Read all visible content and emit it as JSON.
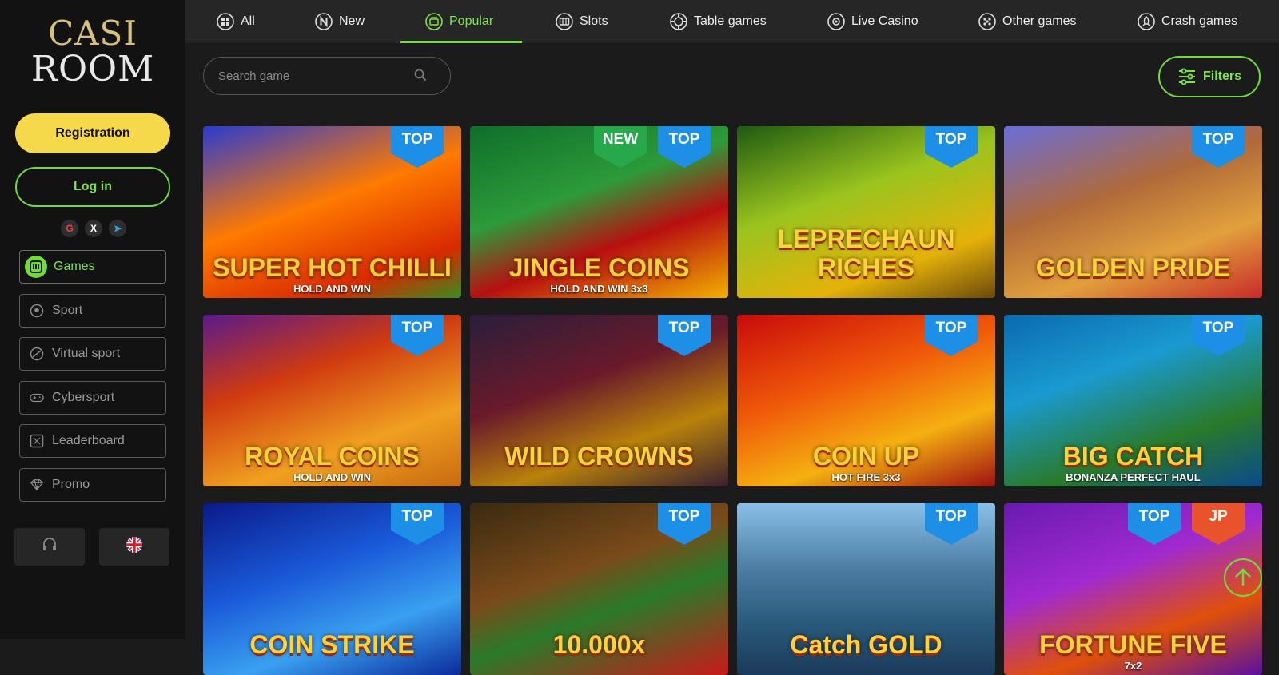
{
  "logo": {
    "line1": "CASI",
    "line2": "ROOM"
  },
  "auth": {
    "registration_label": "Registration",
    "login_label": "Log in"
  },
  "socials": [
    {
      "icon": "google-icon",
      "glyph": "G"
    },
    {
      "icon": "x-icon",
      "glyph": "X"
    },
    {
      "icon": "telegram-icon",
      "glyph": "➤"
    }
  ],
  "sidebar": {
    "items": [
      {
        "label": "Games",
        "icon": "slot-machine-icon",
        "active": true
      },
      {
        "label": "Sport",
        "icon": "soccer-ball-icon"
      },
      {
        "label": "Virtual sport",
        "icon": "virtual-ball-icon"
      },
      {
        "label": "Cybersport",
        "icon": "gamepad-icon"
      },
      {
        "label": "Leaderboard",
        "icon": "leaderboard-icon"
      },
      {
        "label": "Promo",
        "icon": "diamond-icon"
      }
    ]
  },
  "tabs": [
    {
      "label": "All",
      "icon": "grid-icon"
    },
    {
      "label": "New",
      "icon": "new-badge-icon"
    },
    {
      "label": "Popular",
      "icon": "popular-icon",
      "active": true
    },
    {
      "label": "Slots",
      "icon": "slots-icon"
    },
    {
      "label": "Table games",
      "icon": "chip-icon"
    },
    {
      "label": "Live Casino",
      "icon": "live-icon"
    },
    {
      "label": "Other games",
      "icon": "dice-icon"
    },
    {
      "label": "Crash games",
      "icon": "rocket-icon"
    }
  ],
  "search": {
    "placeholder": "Search game"
  },
  "filters_label": "Filters",
  "games": [
    {
      "title": "SUPER HOT CHILLI",
      "subtitle": "HOLD AND WIN",
      "badges": [
        "TOP"
      ],
      "bg": "linear-gradient(160deg,#2a3bd0 0%,#ff7a00 45%,#d82a00 80%,#3a8a1e 100%)"
    },
    {
      "title": "JINGLE COINS",
      "subtitle": "HOLD AND WIN 3x3",
      "badges": [
        "NEW",
        "TOP"
      ],
      "bg": "linear-gradient(160deg,#0f6e2a 0%,#2c9b3a 40%,#b80f10 65%,#f3b000 100%)"
    },
    {
      "title": "LEPRECHAUN RICHES",
      "subtitle": "",
      "badges": [
        "TOP"
      ],
      "bg": "linear-gradient(160deg,#1e5a12 0%,#9bc41e 40%,#e4b20a 75%,#6b4a0a 100%)"
    },
    {
      "title": "GOLDEN PRIDE",
      "subtitle": "",
      "badges": [
        "TOP"
      ],
      "bg": "linear-gradient(160deg,#6a6ed8 0%,#b06a3a 40%,#e2a03c 70%,#c82a2a 100%)"
    },
    {
      "title": "ROYAL COINS",
      "subtitle": "HOLD AND WIN",
      "badges": [
        "TOP"
      ],
      "bg": "linear-gradient(160deg,#5a1a8a 0%,#d03a10 35%,#f0a020 70%,#c86a10 100%)"
    },
    {
      "title": "WILD CROWNS",
      "subtitle": "",
      "badges": [
        "TOP"
      ],
      "bg": "linear-gradient(160deg,#2a1e3a 0%,#6a1a2a 40%,#b8820a 70%,#3a2030 100%)"
    },
    {
      "title": "COIN UP",
      "subtitle": "HOT FIRE 3x3",
      "badges": [
        "TOP"
      ],
      "bg": "linear-gradient(160deg,#c80a0a 0%,#f05a0a 40%,#f5b010 70%,#a01010 100%)"
    },
    {
      "title": "BIG CATCH",
      "subtitle": "BONANZA PERFECT HAUL",
      "badges": [
        "TOP"
      ],
      "bg": "linear-gradient(160deg,#0a6ab0 0%,#1a9ad0 35%,#2a7a2a 70%,#0a4a8a 100%)"
    },
    {
      "title": "COIN STRIKE",
      "subtitle": "",
      "badges": [
        "TOP"
      ],
      "bg": "linear-gradient(160deg,#0a1a8a 0%,#1a5ad8 40%,#3aa0f0 70%,#0a2a9a 100%)"
    },
    {
      "title": "10.000x",
      "subtitle": "",
      "badges": [
        "TOP"
      ],
      "bg": "linear-gradient(160deg,#3a2a10 0%,#7a4a1a 40%,#2a7a2a 60%,#c81a1a 100%)"
    },
    {
      "title": "Catch GOLD",
      "subtitle": "",
      "badges": [
        "TOP"
      ],
      "bg": "linear-gradient(180deg,#8ac0e8 0%,#4a7aa0 40%,#2a5a7a 70%,#1a3a5a 100%)"
    },
    {
      "title": "FORTUNE FIVE",
      "subtitle": "7x2",
      "badges": [
        "TOP",
        "JP"
      ],
      "bg": "linear-gradient(160deg,#6a1ab0 0%,#a02ad0 40%,#e0500a 70%,#5a10a0 100%)"
    }
  ],
  "colors": {
    "accent": "#6fdc3a",
    "registration": "#f6d94a",
    "top_badge": "#1d8fe6",
    "new_badge": "#27a84a",
    "jp_badge": "#e8532b"
  }
}
